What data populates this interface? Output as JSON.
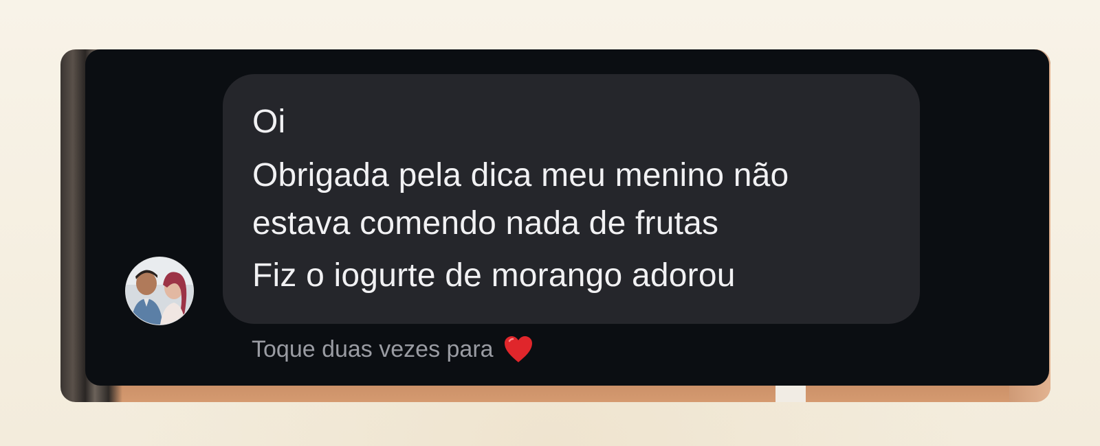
{
  "message": {
    "lines": [
      "Oi",
      "Obrigada pela dica meu menino não",
      "estava comendo nada de frutas",
      "Fiz o iogurte de morango adorou"
    ]
  },
  "hint": {
    "text": "Toque duas vezes para",
    "icon": "heart-icon"
  },
  "colors": {
    "card_background": "#0b0e12",
    "bubble_background": "#25262b",
    "message_text": "#f1f1f3",
    "hint_text": "#9a9ca3",
    "heart": "#e0262b"
  }
}
